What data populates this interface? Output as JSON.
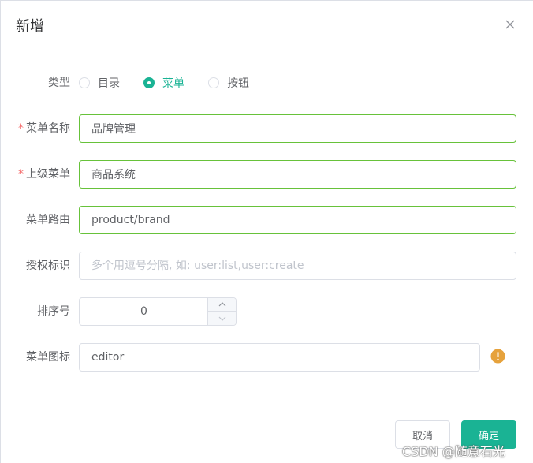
{
  "dialog": {
    "title": "新增"
  },
  "form": {
    "type": {
      "label": "类型",
      "options": [
        {
          "label": "目录",
          "checked": false
        },
        {
          "label": "菜单",
          "checked": true
        },
        {
          "label": "按钮",
          "checked": false
        }
      ]
    },
    "menu_name": {
      "required_mark": "*",
      "label": "菜单名称",
      "value": "品牌管理"
    },
    "parent_menu": {
      "required_mark": "*",
      "label": "上级菜单",
      "value": "商品系统"
    },
    "route": {
      "label": "菜单路由",
      "value": "product/brand"
    },
    "perms": {
      "label": "授权标识",
      "value": "",
      "placeholder": "多个用逗号分隔, 如: user:list,user:create"
    },
    "order": {
      "label": "排序号",
      "value": "0"
    },
    "icon": {
      "label": "菜单图标",
      "value": "editor"
    }
  },
  "footer": {
    "cancel_label": "取消",
    "ok_label": "确定"
  },
  "watermark": "CSDN @随意石光",
  "colors": {
    "accent": "#1ab394",
    "valid_border": "#67c23a",
    "warning": "#e6a23c",
    "required": "#f56c6c"
  },
  "icons": [
    "close-icon",
    "chevron-up-icon",
    "chevron-down-icon",
    "warning-icon"
  ]
}
